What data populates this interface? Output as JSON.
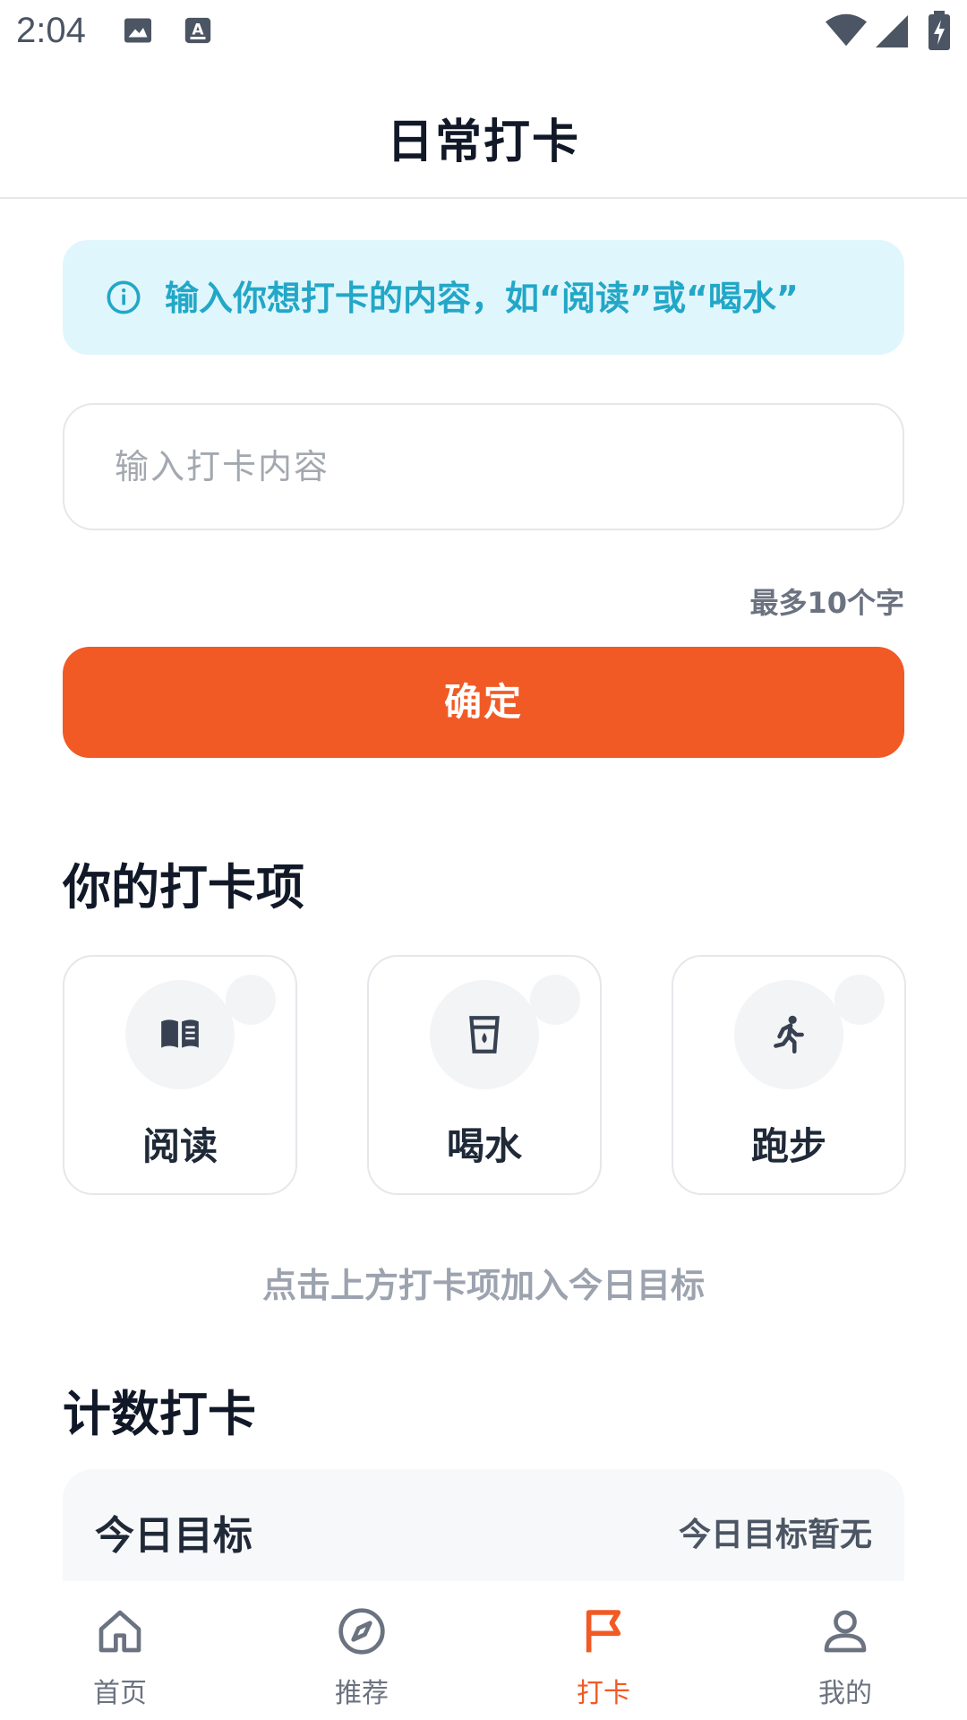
{
  "status_bar": {
    "time": "2:04"
  },
  "header": {
    "title": "日常打卡"
  },
  "tip": {
    "text": "输入你想打卡的内容，如“阅读”或“喝水”",
    "icon": "info-circle-icon"
  },
  "input": {
    "placeholder": "输入打卡内容",
    "value": ""
  },
  "char_limit": "最多10个字",
  "confirm_button": {
    "label": "确定"
  },
  "items_section": {
    "title": "你的打卡项",
    "items": [
      {
        "label": "阅读",
        "icon": "book-icon"
      },
      {
        "label": "喝水",
        "icon": "cup-icon"
      },
      {
        "label": "跑步",
        "icon": "running-icon"
      }
    ],
    "hint": "点击上方打卡项加入今日目标"
  },
  "count_section": {
    "title": "计数打卡",
    "goal_title": "今日目标",
    "goal_status": "今日目标暂无"
  },
  "bottom_nav": [
    {
      "label": "首页",
      "icon": "home-icon",
      "active": false
    },
    {
      "label": "推荐",
      "icon": "compass-icon",
      "active": false
    },
    {
      "label": "打卡",
      "icon": "flag-icon",
      "active": true
    },
    {
      "label": "我的",
      "icon": "user-icon",
      "active": false
    }
  ],
  "colors": {
    "accent": "#f15a24",
    "tip_bg": "#e0f6fd",
    "tip_text": "#22a7c7"
  }
}
